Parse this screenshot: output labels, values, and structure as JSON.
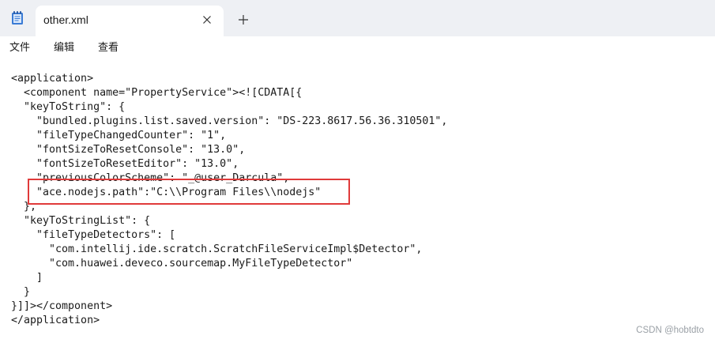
{
  "tab": {
    "title": "other.xml"
  },
  "icons": {
    "app": "notepad-icon",
    "close": "close-icon",
    "new_tab": "plus-icon"
  },
  "menu": [
    {
      "label": "文件"
    },
    {
      "label": "编辑"
    },
    {
      "label": "查看"
    }
  ],
  "lines": [
    "<application>",
    "  <component name=\"PropertyService\"><![CDATA[{",
    "  \"keyToString\": {",
    "    \"bundled.plugins.list.saved.version\": \"DS-223.8617.56.36.310501\",",
    "    \"fileTypeChangedCounter\": \"1\",",
    "    \"fontSizeToResetConsole\": \"13.0\",",
    "    \"fontSizeToResetEditor\": \"13.0\",",
    "    \"previousColorScheme\": \"_@user_Darcula\",",
    "    \"ace.nodejs.path\":\"C:\\\\Program Files\\\\nodejs\"",
    "  },",
    "  \"keyToStringList\": {",
    "    \"fileTypeDetectors\": [",
    "      \"com.intellij.ide.scratch.ScratchFileServiceImpl$Detector\",",
    "      \"com.huawei.deveco.sourcemap.MyFileTypeDetector\"",
    "    ]",
    "  }",
    "}]]></component>",
    "</application>"
  ],
  "highlight_color": "#e03a3a",
  "watermark": "CSDN @hobtdto"
}
